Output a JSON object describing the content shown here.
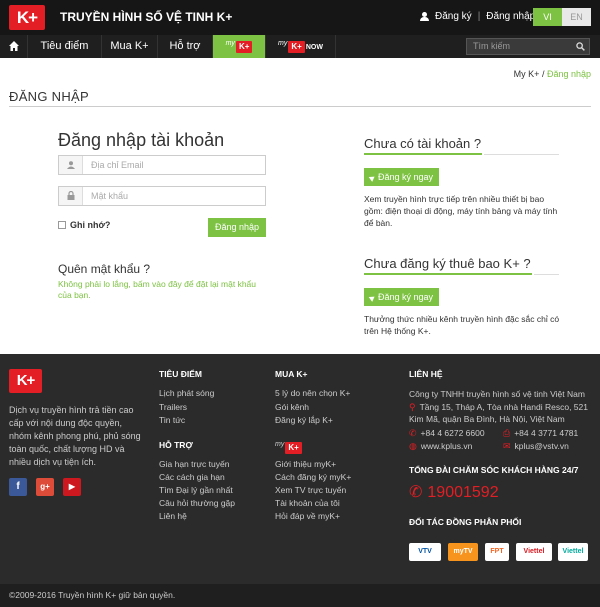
{
  "header": {
    "logo": "K+",
    "title": "TRUYỀN HÌNH SỐ VỆ TINH K+",
    "signup": "Đăng ký",
    "login": "Đăng nhập",
    "lang_vi": "VI",
    "lang_en": "EN"
  },
  "nav": {
    "items": [
      "Tiêu điểm",
      "Mua K+",
      "Hỗ trợ"
    ],
    "mykplus": {
      "my": "my",
      "k": "K+"
    },
    "mykplusnow": {
      "my": "my",
      "k": "K+",
      "now": "NOW"
    },
    "search_placeholder": "Tìm kiếm"
  },
  "breadcrumb": {
    "home": "My K+",
    "sep": " / ",
    "current": "Đăng nhập"
  },
  "page_title": "ĐĂNG NHẬP",
  "login": {
    "title": "Đăng nhập tài khoản",
    "email_placeholder": "Địa chỉ Email",
    "password_placeholder": "Mật khẩu",
    "remember": "Ghi nhớ?",
    "submit": "Đăng nhập",
    "forgot_title": "Quên mật khẩu ?",
    "forgot_text": "Không phải lo lắng, bấm vào đây để đặt lại mật khẩu của bạn."
  },
  "no_account": {
    "title": "Chưa có tài khoản ?",
    "button": "Đăng ký ngay",
    "text": "Xem truyền hình trực tiếp trên nhiều thiết bị bao gồm: điện thoại di động, máy tính bảng và máy tính để bàn."
  },
  "no_subscription": {
    "title": "Chưa đăng ký thuê bao K+ ?",
    "button": "Đăng ký ngay",
    "text": "Thưởng thức nhiều kênh truyền hình đặc sắc chỉ có trên Hệ thống K+."
  },
  "footer": {
    "logo": "K+",
    "description": "Dịch vụ truyền hình trả tiền cao cấp với nội dung độc quyền, nhóm kênh phong phú, phủ sóng toàn quốc, chất lượng HD và nhiều dịch vụ tiện ích.",
    "social": [
      "f",
      "g+",
      "▶"
    ],
    "col1": {
      "title": "TIÊU ĐIỂM",
      "links": [
        "Lịch phát sóng",
        "Trailers",
        "Tin tức"
      ]
    },
    "col1b": {
      "title": "HỖ TRỢ",
      "links": [
        "Gia hạn trực tuyến",
        "Các cách gia hạn",
        "Tìm Đại lý gần nhất",
        "Câu hỏi thường gặp",
        "Liên hệ"
      ]
    },
    "col2": {
      "title": "MUA K+",
      "links": [
        "5 lý do nên chọn K+",
        "Gói kênh",
        "Đăng ký lắp K+"
      ]
    },
    "col2b": {
      "logo_my": "my",
      "logo_k": "K+",
      "links": [
        "Giới thiệu myK+",
        "Cách đăng ký myK+",
        "Xem TV trực tuyến",
        "Tài khoản của tôi",
        "Hỏi đáp về myK+"
      ]
    },
    "contact": {
      "title": "LIÊN HỆ",
      "company": "Công ty TNHH truyền hình số vệ tinh Việt Nam",
      "address": "Tầng 15, Tháp A, Tòa nhà Handi Resco, 521 Kim Mã, quận Ba Đình, Hà Nội, Việt Nam",
      "phone": "+84 4 6272 6600",
      "fax": "+84 4 3771 4781",
      "web": "www.kplus.vn",
      "email": "kplus@vstv.vn"
    },
    "hotline_title": "TỔNG ĐÀI CHĂM SÓC KHÁCH HÀNG 24/7",
    "hotline": "19001592",
    "partners_title": "ĐỐI TÁC ĐỒNG PHÂN PHỐI",
    "partners": [
      "VTV",
      "myTV",
      "FPT",
      "Viettel",
      "Viettel"
    ],
    "copyright": "©2009-2016 Truyền hình K+ giữ bản quyền."
  },
  "colors": {
    "accent": "#7dc242",
    "brand": "#e31e24",
    "header_bg": "#161616",
    "footer_bg": "#2b2b2b"
  }
}
